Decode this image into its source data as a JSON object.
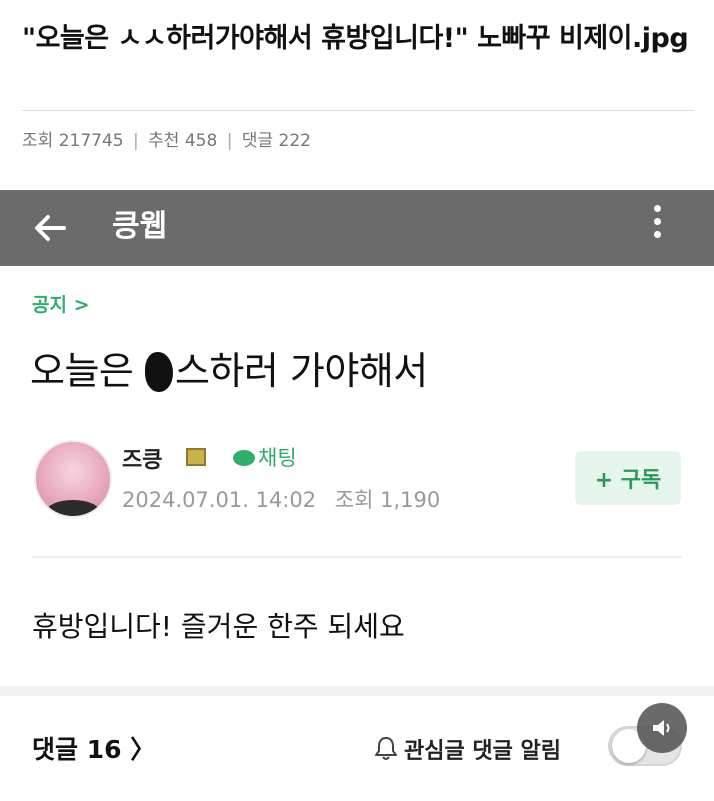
{
  "post": {
    "title": "\"오늘은 ㅅㅅ하러가야해서 휴방입니다!\" 노빠꾸 비제이.jpg",
    "views_label": "조회",
    "views": "217745",
    "likes_label": "추천",
    "likes": "458",
    "comments_label": "댓글",
    "comments": "222"
  },
  "screenshot": {
    "appbar": {
      "title": "킁웹",
      "back_icon": "arrow-left-icon",
      "menu_icon": "more-vertical-icon"
    },
    "notice_link": "공지 >",
    "article_title_suffix": "스하러 가야해서",
    "article_title_prefix": "오늘은 ",
    "author": {
      "name": "즈킁",
      "chat_label": "채팅",
      "date": "2024.07.01. 14:02",
      "views_label": "조회",
      "views": "1,190"
    },
    "subscribe_label": "+ 구독",
    "body": "휴방입니다! 즐거운 한주 되세요",
    "comments_link": "댓글 16 〉",
    "notify_label": "관심글 댓글 알림",
    "notify_toggle_on": false,
    "colors": {
      "accent": "#2fae6a",
      "appbar": "#6b6b6b"
    }
  }
}
